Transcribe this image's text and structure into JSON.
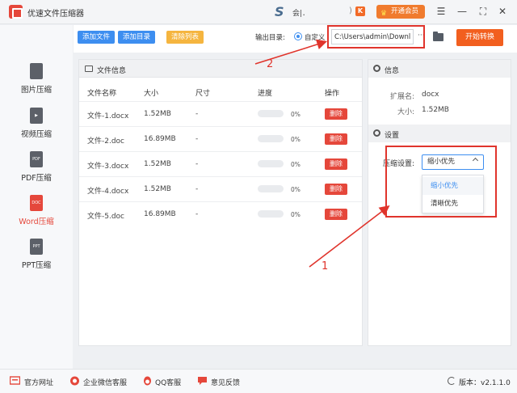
{
  "app": {
    "title": "优速文件压缩器"
  },
  "user": {
    "logo_letter": "S",
    "name": "会|．",
    "paren": ")",
    "vip_badge": "K",
    "vip_button": "开通会员"
  },
  "window_controls": {
    "menu": "☰",
    "minimize": "—",
    "maximize": "⛶",
    "close": "✕"
  },
  "sidebar": {
    "items": [
      {
        "label": "图片压缩",
        "icon_text": ""
      },
      {
        "label": "视频压缩",
        "icon_text": "▶"
      },
      {
        "label": "PDF压缩",
        "icon_text": "PDF"
      },
      {
        "label": "Word压缩",
        "icon_text": "DOC"
      },
      {
        "label": "PPT压缩",
        "icon_text": "PPT"
      }
    ],
    "active_index": 3
  },
  "toolbar": {
    "add_file": "添加文件",
    "add_folder": "添加目录",
    "clear_list": "清除列表",
    "output_label": "输出目录:",
    "custom_option": "自定义",
    "output_path": "C:\\Users\\admin\\Downlo",
    "more": "···",
    "start": "开始转换"
  },
  "file_panel": {
    "title": "文件信息",
    "columns": {
      "name": "文件名称",
      "size": "大小",
      "dims": "尺寸",
      "progress": "进度",
      "action": "操作"
    },
    "delete_label": "删除",
    "rows": [
      {
        "name": "文件-1.docx",
        "size": "1.52MB",
        "dims": "-",
        "progress": 0,
        "progress_text": "0%"
      },
      {
        "name": "文件-2.doc",
        "size": "16.89MB",
        "dims": "-",
        "progress": 0,
        "progress_text": "0%"
      },
      {
        "name": "文件-3.docx",
        "size": "1.52MB",
        "dims": "-",
        "progress": 0,
        "progress_text": "0%"
      },
      {
        "name": "文件-4.docx",
        "size": "1.52MB",
        "dims": "-",
        "progress": 0,
        "progress_text": "0%"
      },
      {
        "name": "文件-5.doc",
        "size": "16.89MB",
        "dims": "-",
        "progress": 0,
        "progress_text": "0%"
      }
    ]
  },
  "info_panel": {
    "info_title": "信息",
    "ext_label": "扩展名:",
    "ext_value": "docx",
    "size_label": "大小:",
    "size_value": "1.52MB",
    "settings_title": "设置",
    "compress_label": "压缩设置:",
    "compress_selected": "缩小优先",
    "compress_options": [
      "缩小优先",
      "清晰优先"
    ]
  },
  "annotations": {
    "label_1": "1",
    "label_2": "2",
    "color": "#e0342c"
  },
  "footer": {
    "website": "官方网址",
    "wechat": "企业微信客服",
    "qq": "QQ客服",
    "feedback": "意见反馈",
    "version": "版本：v2.1.1.0"
  },
  "colors": {
    "accent_blue": "#3d8ef0",
    "accent_red": "#e5473b",
    "start_orange": "#f25f1f",
    "vip_orange": "#f07b2e"
  }
}
